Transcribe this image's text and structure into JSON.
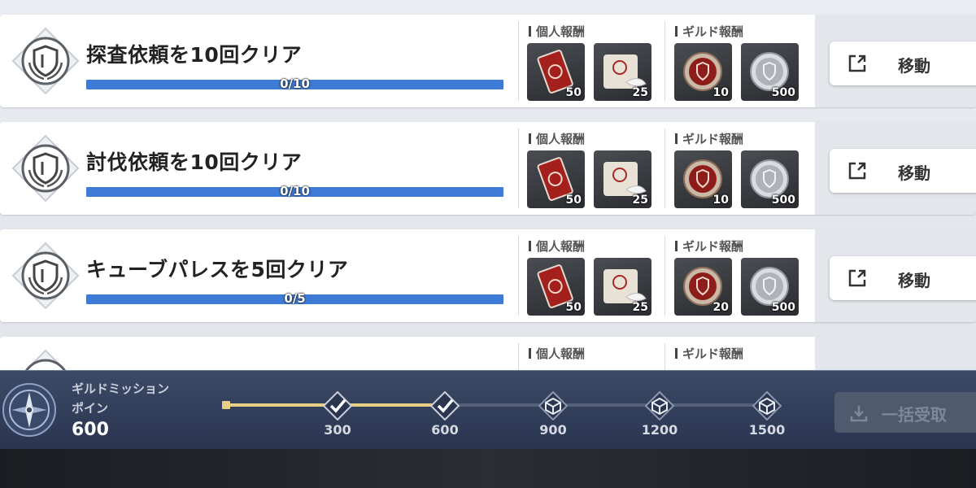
{
  "missions": [
    {
      "title": "探査依頼を10回クリア",
      "progress_text": "0/10",
      "progress_fraction": 0,
      "personal_label": "個人報酬",
      "guild_label": "ギルド報酬",
      "personal_rewards": [
        {
          "item": "red-ticket",
          "qty": "50"
        },
        {
          "item": "scroll-quill",
          "qty": "25"
        }
      ],
      "guild_rewards": [
        {
          "item": "red-medal",
          "qty": "10"
        },
        {
          "item": "silver-medal",
          "qty": "500"
        }
      ],
      "move_label": "移動"
    },
    {
      "title": "討伐依頼を10回クリア",
      "progress_text": "0/10",
      "progress_fraction": 0,
      "personal_label": "個人報酬",
      "guild_label": "ギルド報酬",
      "personal_rewards": [
        {
          "item": "red-ticket",
          "qty": "50"
        },
        {
          "item": "scroll-quill",
          "qty": "25"
        }
      ],
      "guild_rewards": [
        {
          "item": "red-medal",
          "qty": "10"
        },
        {
          "item": "silver-medal",
          "qty": "500"
        }
      ],
      "move_label": "移動"
    },
    {
      "title": "キューブパレスを5回クリア",
      "progress_text": "0/5",
      "progress_fraction": 0,
      "personal_label": "個人報酬",
      "guild_label": "ギルド報酬",
      "personal_rewards": [
        {
          "item": "red-ticket",
          "qty": "50"
        },
        {
          "item": "scroll-quill",
          "qty": "25"
        }
      ],
      "guild_rewards": [
        {
          "item": "red-medal",
          "qty": "20"
        },
        {
          "item": "silver-medal",
          "qty": "500"
        }
      ],
      "move_label": "移動"
    },
    {
      "title": "",
      "personal_label": "個人報酬",
      "guild_label": "ギルド報酬"
    }
  ],
  "points": {
    "label": "ギルドミッションポイン",
    "value": "600",
    "progress_fraction": 0.4,
    "milestones": [
      {
        "label": "300",
        "state": "claimed",
        "icon": "check-icon"
      },
      {
        "label": "600",
        "state": "claimed",
        "icon": "check-icon"
      },
      {
        "label": "900",
        "state": "locked",
        "icon": "cube-icon"
      },
      {
        "label": "1200",
        "state": "locked",
        "icon": "cube-icon"
      },
      {
        "label": "1500",
        "state": "locked",
        "icon": "cube-icon"
      }
    ],
    "claim_all_label": "一括受取"
  },
  "colors": {
    "progress_blue": "#3d7bd6",
    "points_gold": "#e9cf86",
    "bar_navy": "#2f3c58"
  }
}
